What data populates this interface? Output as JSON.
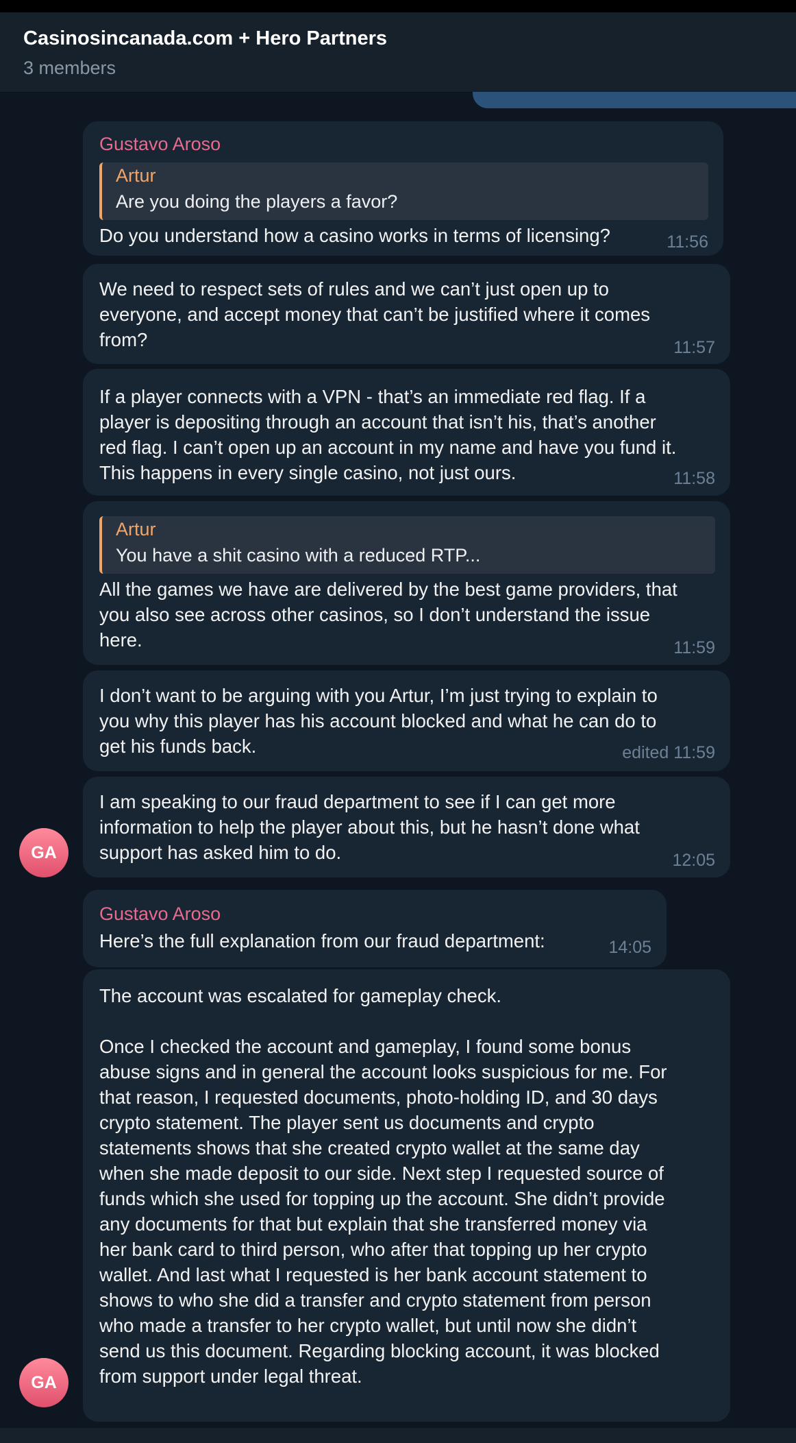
{
  "header": {
    "title": "Casinosincanada.com + Hero Partners",
    "subtitle": "3 members"
  },
  "messages": [
    {
      "sender": "Gustavo Aroso",
      "reply": {
        "name": "Artur",
        "text": "Are you doing the players a favor?"
      },
      "text": "Do you understand how a casino works in terms of licensing?",
      "time": "11:56"
    },
    {
      "text": "We need to respect sets of rules and we can’t just open up to\neveryone, and accept money that can’t be justified where it comes\nfrom?",
      "time": "11:57"
    },
    {
      "text": "If a player connects with a VPN - that’s an immediate red flag. If a\nplayer is depositing through an account that isn’t his, that’s another\nred flag. I can’t open up an account in my name and have you fund it.\nThis happens in every single casino, not just ours.",
      "time": "11:58"
    },
    {
      "reply": {
        "name": "Artur",
        "text": "You have a shit casino with a reduced RTP..."
      },
      "text": "All the games we have are delivered by the best game providers, that\nyou also see across other casinos, so I don’t understand the issue\nhere.",
      "time": "11:59"
    },
    {
      "text": "I don’t want to be arguing with you Artur, I’m just trying to explain to\nyou why this player has his account blocked and what he can do to\nget his funds back.",
      "time": "edited 11:59"
    },
    {
      "text": "I am speaking to our fraud department to see if I can get more\ninformation to help the player about this, but he hasn’t done what\nsupport has asked him to do.",
      "time": "12:05"
    },
    {
      "sender": "Gustavo Aroso",
      "text": "Here’s the full explanation from our fraud department:",
      "time": "14:05"
    },
    {
      "text": "The account was escalated for gameplay check.\n\nOnce I checked the account and gameplay, I found some bonus\nabuse signs and in general the account looks suspicious for me. For\nthat reason, I requested documents, photo-holding ID, and 30 days\ncrypto statement. The player sent us documents and crypto\nstatements shows that she created crypto wallet at the same day\nwhen she made deposit to our side. Next step I requested source of\nfunds which she used for topping up the account. She didn’t provide\nany documents for that but explain that she transferred money via\nher bank card to third person, who after that topping up her crypto\nwallet. And last what I requested is her bank account statement to\nshows to who she did a transfer and crypto statement from person\nwho made a transfer to her crypto wallet, but until now she didn’t\nsend us this document. Regarding blocking account, it was blocked\nfrom support under legal threat."
    }
  ],
  "avatars": {
    "initials": "GA"
  }
}
